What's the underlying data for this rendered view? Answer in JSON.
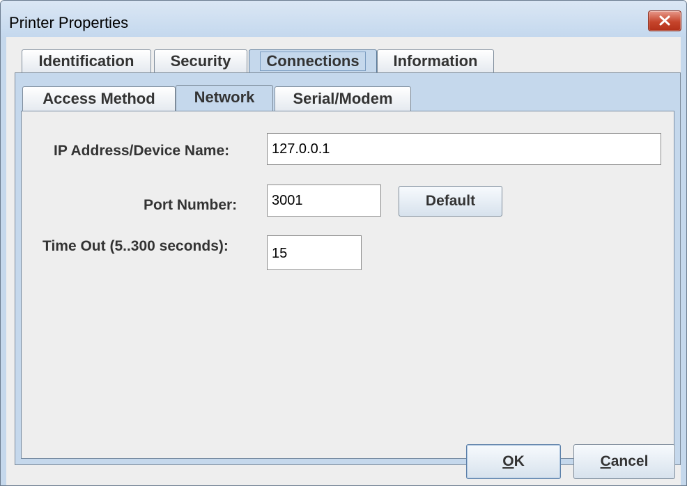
{
  "window": {
    "title": "Printer Properties",
    "close_icon": "close-icon"
  },
  "outer_tabs": [
    {
      "label": "Identification",
      "active": false
    },
    {
      "label": "Security",
      "active": false
    },
    {
      "label": "Connections",
      "active": true
    },
    {
      "label": "Information",
      "active": false
    }
  ],
  "inner_tabs": [
    {
      "label": "Access Method",
      "active": false
    },
    {
      "label": "Network",
      "active": true
    },
    {
      "label": "Serial/Modem",
      "active": false
    }
  ],
  "form": {
    "ip_label": "IP Address/Device Name:",
    "ip_value": "127.0.0.1",
    "port_label": "Port Number:",
    "port_value": "3001",
    "default_button": "Default",
    "timeout_label": "Time Out (5..300 seconds):",
    "timeout_value": "15"
  },
  "footer": {
    "ok_mnemonic": "O",
    "ok_rest": "K",
    "cancel_mnemonic": "C",
    "cancel_rest": "ancel"
  },
  "colors": {
    "tab_panel": "#c5d8ec",
    "body": "#eeeeee",
    "close_button": "#c6452c"
  }
}
